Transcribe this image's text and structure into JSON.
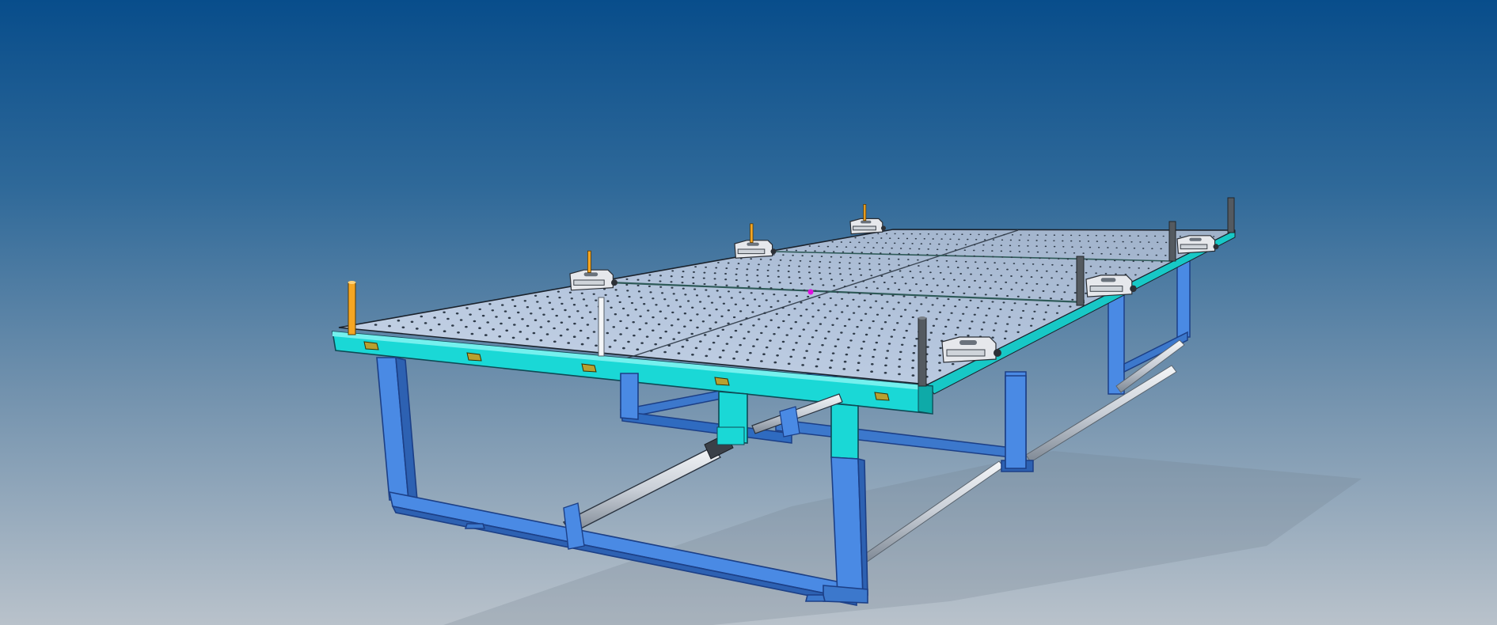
{
  "viewport": {
    "background_top": "#084d8b",
    "background_bottom": "#b9c2cb"
  },
  "model": {
    "frame_color": "#4a8ae4",
    "frame_edge_color": "#1c3f86",
    "rail_color": "#1ad8d6",
    "plate_color": "#b4c6de",
    "hole_color": "#2e3a48",
    "post_orange_color": "#f5a623",
    "post_dark_color": "#545a60",
    "clamp_color": "#e6e8ec",
    "marker_color": "#e010e0"
  }
}
